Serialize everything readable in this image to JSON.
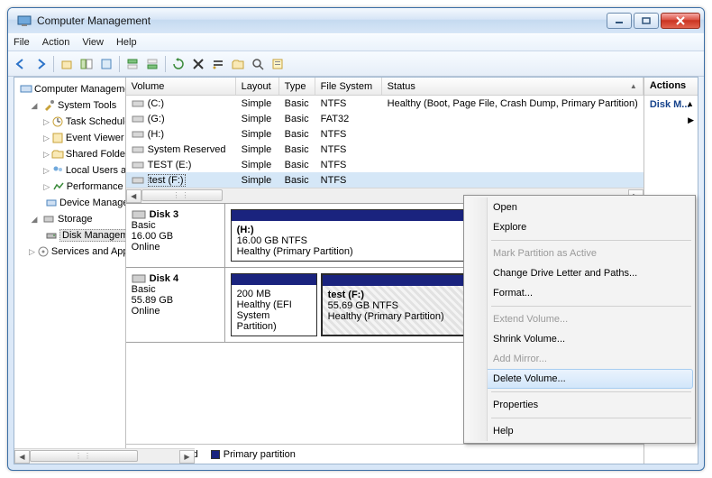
{
  "window": {
    "title": "Computer Management"
  },
  "menubar": [
    "File",
    "Action",
    "View",
    "Help"
  ],
  "tree": {
    "root": "Computer Management (Local)",
    "system_tools": "System Tools",
    "task_scheduler": "Task Scheduler",
    "event_viewer": "Event Viewer",
    "shared_folders": "Shared Folders",
    "local_users": "Local Users and Groups",
    "performance": "Performance",
    "device_manager": "Device Manager",
    "storage": "Storage",
    "disk_management": "Disk Management",
    "services_apps": "Services and Applications"
  },
  "columns": {
    "volume": "Volume",
    "layout": "Layout",
    "type": "Type",
    "filesystem": "File System",
    "status": "Status"
  },
  "volumes": [
    {
      "name": "(C:)",
      "layout": "Simple",
      "type": "Basic",
      "fs": "NTFS",
      "status": "Healthy (Boot, Page File, Crash Dump, Primary Partition)"
    },
    {
      "name": "(G:)",
      "layout": "Simple",
      "type": "Basic",
      "fs": "FAT32",
      "status": ""
    },
    {
      "name": "(H:)",
      "layout": "Simple",
      "type": "Basic",
      "fs": "NTFS",
      "status": ""
    },
    {
      "name": "System Reserved",
      "layout": "Simple",
      "type": "Basic",
      "fs": "NTFS",
      "status": ""
    },
    {
      "name": "TEST (E:)",
      "layout": "Simple",
      "type": "Basic",
      "fs": "NTFS",
      "status": ""
    },
    {
      "name": "test (F:)",
      "layout": "Simple",
      "type": "Basic",
      "fs": "NTFS",
      "status": ""
    }
  ],
  "disks": {
    "d3": {
      "name": "Disk 3",
      "type": "Basic",
      "size": "16.00 GB",
      "state": "Online",
      "p1": {
        "label": "(H:)",
        "line2": "16.00 GB NTFS",
        "line3": "Healthy (Primary Partition)"
      }
    },
    "d4": {
      "name": "Disk 4",
      "type": "Basic",
      "size": "55.89 GB",
      "state": "Online",
      "p1": {
        "label": "",
        "line2": "200 MB",
        "line3": "Healthy (EFI System Partition)"
      },
      "p2": {
        "label": "test  (F:)",
        "line2": "55.69 GB NTFS",
        "line3": "Healthy (Primary Partition)"
      }
    }
  },
  "legend": {
    "unallocated": "Unallocated",
    "primary": "Primary partition"
  },
  "actions": {
    "header": "Actions",
    "sub": "Disk M..."
  },
  "context_menu": {
    "open": "Open",
    "explore": "Explore",
    "mark_active": "Mark Partition as Active",
    "change_letter": "Change Drive Letter and Paths...",
    "format": "Format...",
    "extend": "Extend Volume...",
    "shrink": "Shrink Volume...",
    "add_mirror": "Add Mirror...",
    "delete": "Delete Volume...",
    "properties": "Properties",
    "help": "Help"
  }
}
